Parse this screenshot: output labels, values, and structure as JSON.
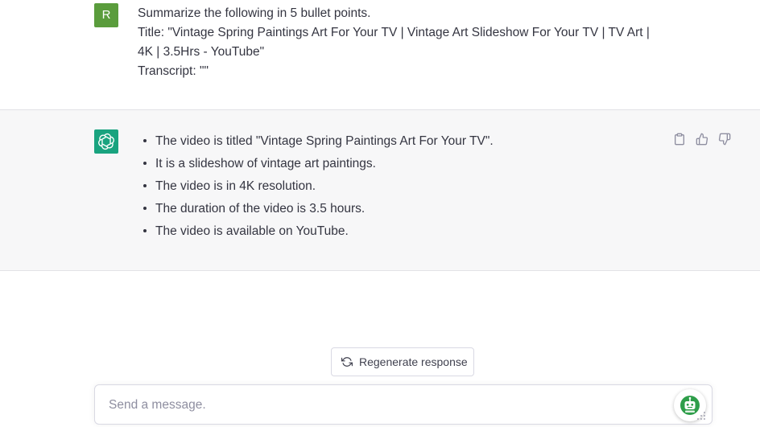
{
  "conversation": {
    "user": {
      "avatar_letter": "R",
      "avatar_color": "#5a9c3c",
      "lines": [
        "Summarize the following in 5 bullet points.",
        "Title: \"Vintage Spring Paintings Art For Your TV | Vintage Art Slideshow For Your TV | TV Art |",
        "4K | 3.5Hrs - YouTube\"",
        "Transcript: \"\""
      ]
    },
    "assistant": {
      "avatar_icon": "openai-logo-icon",
      "avatar_color": "#19a37f",
      "bullets": [
        "The video is titled \"Vintage Spring Paintings Art For Your TV\".",
        "It is a slideshow of vintage art paintings.",
        "The video is in 4K resolution.",
        "The duration of the video is 3.5 hours.",
        "The video is available on YouTube."
      ],
      "actions": [
        "clipboard-icon",
        "thumbs-up-icon",
        "thumbs-down-icon"
      ]
    }
  },
  "controls": {
    "regenerate_label": "Regenerate response",
    "regenerate_icon": "refresh-icon",
    "input_placeholder": "Send a message.",
    "input_value": "",
    "extension_icon": "robot-extension-icon"
  }
}
